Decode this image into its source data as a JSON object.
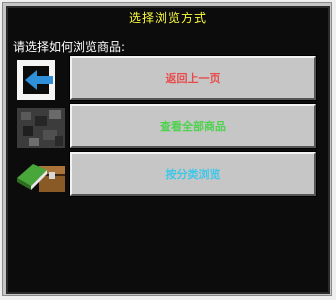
{
  "window": {
    "title": "选择浏览方式"
  },
  "prompt": "请选择如何浏览商品:",
  "options": [
    {
      "label": "返回上一页",
      "color": "#e84a4a",
      "icon": "back-arrow-icon"
    },
    {
      "label": "查看全部商品",
      "color": "#4fd24f",
      "icon": "stone-block-icon"
    },
    {
      "label": "按分类浏览",
      "color": "#3fc7e8",
      "icon": "book-chest-icon"
    }
  ]
}
